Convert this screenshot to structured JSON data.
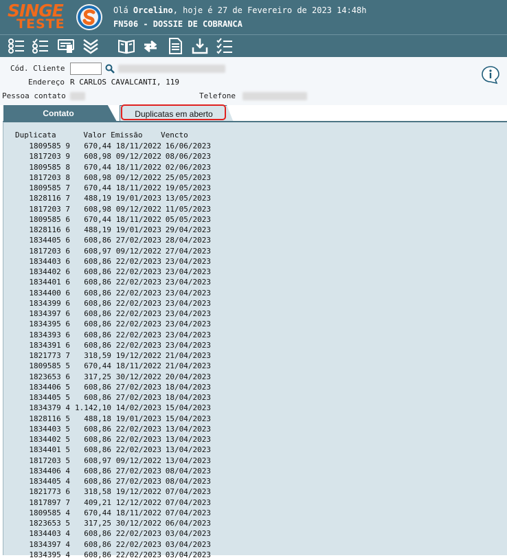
{
  "header": {
    "logo_top": "SINGE",
    "logo_bottom": "TESTE",
    "greeting_prefix": "Olá ",
    "user_name": "Orcelino",
    "greeting_suffix": ", hoje é 27 de Fevereiro de 2023 14:48h",
    "screen_title": "FN506 - DOSSIE DE COBRANCA"
  },
  "toolbar": {
    "icons": [
      "list-check-icon",
      "checklist-icon",
      "form-icon",
      "collapse-chevrons-icon",
      "book-icon",
      "refresh-icon",
      "document-icon",
      "download-icon",
      "tasks-icon"
    ]
  },
  "form": {
    "cod_cliente_label": "Cód. Cliente",
    "endereco_label": "Endereço",
    "endereco_value": "R CARLOS CAVALCANTI, 119",
    "pessoa_contato_label": "Pessoa contato",
    "telefone_label": "Telefone"
  },
  "tabs": {
    "contato": "Contato",
    "duplicatas": "Duplicatas em aberto"
  },
  "table": {
    "headers": {
      "duplicata": "Duplicata",
      "valor": "Valor",
      "emissao": "Emissão",
      "vencto": "Vencto"
    },
    "rows": [
      [
        "1809585 9",
        "670,44",
        "18/11/2022",
        "16/06/2023"
      ],
      [
        "1817203 9",
        "608,98",
        "09/12/2022",
        "08/06/2023"
      ],
      [
        "1809585 8",
        "670,44",
        "18/11/2022",
        "02/06/2023"
      ],
      [
        "1817203 8",
        "608,98",
        "09/12/2022",
        "25/05/2023"
      ],
      [
        "1809585 7",
        "670,44",
        "18/11/2022",
        "19/05/2023"
      ],
      [
        "1828116 7",
        "488,19",
        "19/01/2023",
        "13/05/2023"
      ],
      [
        "1817203 7",
        "608,98",
        "09/12/2022",
        "11/05/2023"
      ],
      [
        "1809585 6",
        "670,44",
        "18/11/2022",
        "05/05/2023"
      ],
      [
        "1828116 6",
        "488,19",
        "19/01/2023",
        "29/04/2023"
      ],
      [
        "1834405 6",
        "608,86",
        "27/02/2023",
        "28/04/2023"
      ],
      [
        "1817203 6",
        "608,97",
        "09/12/2022",
        "27/04/2023"
      ],
      [
        "1834403 6",
        "608,86",
        "22/02/2023",
        "23/04/2023"
      ],
      [
        "1834402 6",
        "608,86",
        "22/02/2023",
        "23/04/2023"
      ],
      [
        "1834401 6",
        "608,86",
        "22/02/2023",
        "23/04/2023"
      ],
      [
        "1834400 6",
        "608,86",
        "22/02/2023",
        "23/04/2023"
      ],
      [
        "1834399 6",
        "608,86",
        "22/02/2023",
        "23/04/2023"
      ],
      [
        "1834397 6",
        "608,86",
        "22/02/2023",
        "23/04/2023"
      ],
      [
        "1834395 6",
        "608,86",
        "22/02/2023",
        "23/04/2023"
      ],
      [
        "1834393 6",
        "608,86",
        "22/02/2023",
        "23/04/2023"
      ],
      [
        "1834391 6",
        "608,86",
        "22/02/2023",
        "23/04/2023"
      ],
      [
        "1821773 7",
        "318,59",
        "19/12/2022",
        "21/04/2023"
      ],
      [
        "1809585 5",
        "670,44",
        "18/11/2022",
        "21/04/2023"
      ],
      [
        "1823653 6",
        "317,25",
        "30/12/2022",
        "20/04/2023"
      ],
      [
        "1834406 5",
        "608,86",
        "27/02/2023",
        "18/04/2023"
      ],
      [
        "1834405 5",
        "608,86",
        "27/02/2023",
        "18/04/2023"
      ],
      [
        "1834379 4",
        "1.142,10",
        "14/02/2023",
        "15/04/2023"
      ],
      [
        "1828116 5",
        "488,18",
        "19/01/2023",
        "15/04/2023"
      ],
      [
        "1834403 5",
        "608,86",
        "22/02/2023",
        "13/04/2023"
      ],
      [
        "1834402 5",
        "608,86",
        "22/02/2023",
        "13/04/2023"
      ],
      [
        "1834401 5",
        "608,86",
        "22/02/2023",
        "13/04/2023"
      ],
      [
        "1817203 5",
        "608,97",
        "09/12/2022",
        "13/04/2023"
      ],
      [
        "1834406 4",
        "608,86",
        "27/02/2023",
        "08/04/2023"
      ],
      [
        "1834405 4",
        "608,86",
        "27/02/2023",
        "08/04/2023"
      ],
      [
        "1821773 6",
        "318,58",
        "19/12/2022",
        "07/04/2023"
      ],
      [
        "1817897 7",
        "409,21",
        "12/12/2022",
        "07/04/2023"
      ],
      [
        "1809585 4",
        "670,44",
        "18/11/2022",
        "07/04/2023"
      ],
      [
        "1823653 5",
        "317,25",
        "30/12/2022",
        "06/04/2023"
      ],
      [
        "1834403 4",
        "608,86",
        "22/02/2023",
        "03/04/2023"
      ],
      [
        "1834397 4",
        "608,86",
        "22/02/2023",
        "03/04/2023"
      ],
      [
        "1834395 4",
        "608,86",
        "22/02/2023",
        "03/04/2023"
      ]
    ]
  }
}
